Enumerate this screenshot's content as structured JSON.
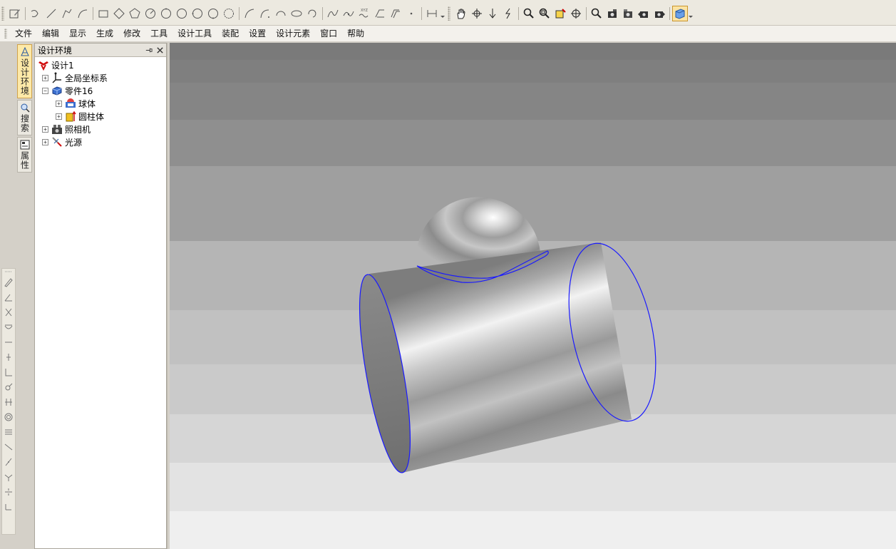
{
  "menu": [
    "文件",
    "编辑",
    "显示",
    "生成",
    "修改",
    "工具",
    "设计工具",
    "装配",
    "设置",
    "设计元素",
    "窗口",
    "帮助"
  ],
  "side_tabs": [
    {
      "label": "设计环境",
      "icon": "design-env-icon",
      "active": true
    },
    {
      "label": "搜索",
      "icon": "search-icon",
      "active": false
    },
    {
      "label": "属性",
      "icon": "properties-icon",
      "active": false
    }
  ],
  "panel": {
    "title": "设计环境",
    "tree": {
      "root": "设计1",
      "global_coords": "全局坐标系",
      "part": "零件16",
      "sphere": "球体",
      "cylinder": "圆柱体",
      "camera": "照相机",
      "light": "光源"
    }
  },
  "colors": {
    "accent": "#fde9a8",
    "edge": "#1a1aff",
    "viewport_top": "#7b7b7b",
    "viewport_bottom": "#efefef"
  }
}
